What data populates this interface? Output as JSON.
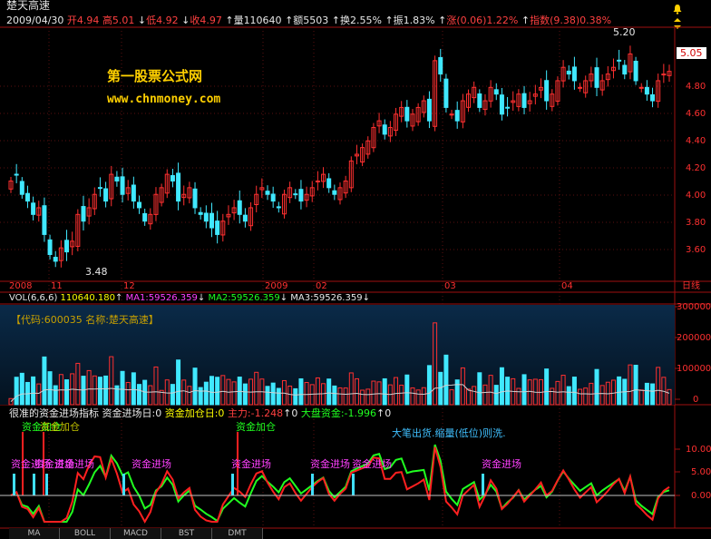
{
  "window": {
    "title": "楚天高速"
  },
  "quote": {
    "date": "2009/04/30",
    "open_label": "开",
    "open": "4.94",
    "high_label": "高",
    "high": "5.01",
    "low_label": "低",
    "low": "4.92",
    "close_label": "收",
    "close": "4.97",
    "vol_label": "量",
    "vol": "110640",
    "amt_label": "额",
    "amt": "5503",
    "turn_label": "换",
    "turn": "2.55%",
    "amp_label": "振",
    "amp": "1.83%",
    "chg_label": "涨",
    "chg": "(0.06)1.22%",
    "idx_label": "指数",
    "idx": "(9.38)0.38%"
  },
  "price_chart": {
    "max_marker": "5.20",
    "min_marker": "3.48",
    "current": "5.05",
    "y_labels": [
      "4.80",
      "4.60",
      "4.40",
      "4.20",
      "4.00",
      "3.80",
      "3.60"
    ],
    "x_labels": [
      "2008",
      "11",
      "12",
      "2009",
      "02",
      "03",
      "04"
    ],
    "period": "日线",
    "logo_line1": "第一股票公式网",
    "logo_line2": "www.chnmoney.com"
  },
  "volume_panel": {
    "vol_name": "VOL(6,6,6)",
    "vol": "110640.180",
    "ma1": "MA1:59526.359",
    "ma2": "MA2:59526.359",
    "ma3": "MA3:59526.359",
    "code_text": "【代码:600035 名称:楚天高速】",
    "y_labels": [
      "300000",
      "200000",
      "100000",
      "0"
    ]
  },
  "indicator_panel": {
    "name": "很准的资金进场指标",
    "in_day": "资金进场日:0",
    "add_day": "资金加仓日:0",
    "main": "主力:-1.248",
    "main_arrow": "↑0",
    "market": "大盘资金:-1.996",
    "market_arrow": "↑0",
    "note": "大笔出货.缩量(低位)则洗.",
    "add_label": "资金加仓",
    "in_label": "资金进场",
    "y_labels": [
      "10.00",
      "5.00",
      "0.00"
    ]
  },
  "tabs": [
    "MA",
    "BOLL",
    "MACD",
    "BST",
    "DMT"
  ],
  "chart_data": {
    "type": "candlestick",
    "price_ylim": [
      3.4,
      5.3
    ],
    "closes": [
      4.15,
      4.2,
      4.05,
      4.0,
      3.9,
      3.95,
      3.75,
      3.6,
      3.55,
      3.65,
      3.62,
      3.7,
      3.9,
      3.85,
      3.95,
      4.05,
      4.1,
      4.0,
      4.2,
      4.15,
      4.05,
      4.1,
      4.0,
      3.95,
      3.85,
      3.9,
      4.05,
      4.1,
      4.2,
      4.15,
      4.0,
      4.05,
      4.1,
      3.95,
      3.9,
      3.85,
      3.8,
      3.75,
      3.85,
      3.9,
      3.95,
      3.9,
      3.85,
      3.95,
      4.05,
      4.1,
      4.05,
      4.0,
      3.95,
      4.05,
      4.1,
      4.05,
      4.0,
      4.05,
      4.1,
      4.15,
      4.2,
      4.1,
      4.05,
      4.1,
      4.15,
      4.3,
      4.35,
      4.4,
      4.45,
      4.55,
      4.6,
      4.5,
      4.55,
      4.65,
      4.7,
      4.6,
      4.65,
      4.7,
      4.75,
      4.6,
      5.05,
      4.95,
      4.7,
      4.65,
      4.6,
      4.75,
      4.8,
      4.85,
      4.7,
      4.75,
      4.85,
      4.8,
      4.65,
      4.7,
      4.75,
      4.8,
      4.7,
      4.75,
      4.8,
      4.85,
      4.75,
      4.8,
      4.9,
      5.0,
      4.95,
      4.9,
      4.85,
      4.9,
      4.95,
      4.85,
      4.9,
      4.95,
      5.0,
      5.05,
      4.95,
      5.1,
      4.9,
      4.85,
      4.8,
      4.75,
      4.9,
      4.95,
      4.97
    ]
  }
}
